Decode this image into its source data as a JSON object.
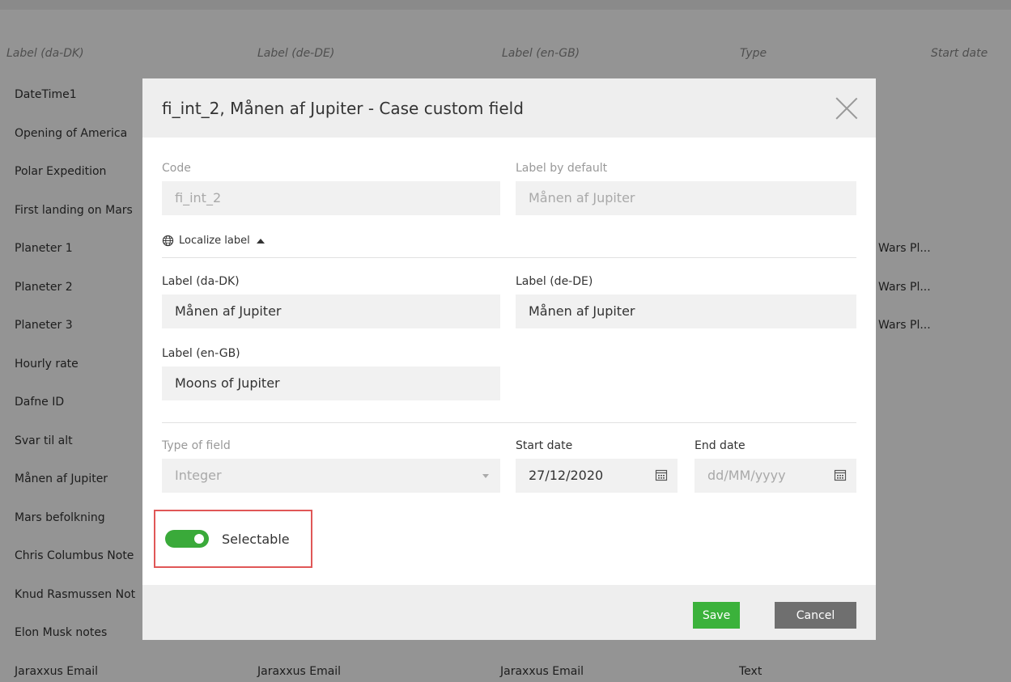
{
  "table": {
    "headers": [
      "Label (da-DK)",
      "Label (de-DE)",
      "Label (en-GB)",
      "Type",
      "Start date"
    ],
    "rows": [
      {
        "c0": "DateTime1",
        "c1": "",
        "c2": "",
        "c3": "",
        "c4": ""
      },
      {
        "c0": "Opening of America",
        "c1": "",
        "c2": "",
        "c3": "",
        "c4": ""
      },
      {
        "c0": "Polar Expedition",
        "c1": "",
        "c2": "",
        "c3": "",
        "c4": ""
      },
      {
        "c0": "First landing on Mars",
        "c1": "",
        "c2": "",
        "c3": "",
        "c4": ""
      },
      {
        "c0": "Planeter 1",
        "c1": "",
        "c2": "",
        "c3": "",
        "c4": "Wars Pl..."
      },
      {
        "c0": "Planeter 2",
        "c1": "",
        "c2": "",
        "c3": "",
        "c4": "Wars Pl..."
      },
      {
        "c0": "Planeter 3",
        "c1": "",
        "c2": "",
        "c3": "",
        "c4": "Wars Pl..."
      },
      {
        "c0": "Hourly rate",
        "c1": "",
        "c2": "",
        "c3": "",
        "c4": ""
      },
      {
        "c0": "Dafne ID",
        "c1": "",
        "c2": "",
        "c3": "",
        "c4": ""
      },
      {
        "c0": "Svar til alt",
        "c1": "",
        "c2": "",
        "c3": "",
        "c4": ""
      },
      {
        "c0": "Månen af Jupiter",
        "c1": "",
        "c2": "",
        "c3": "",
        "c4": ""
      },
      {
        "c0": "Mars befolkning",
        "c1": "",
        "c2": "",
        "c3": "",
        "c4": ""
      },
      {
        "c0": "Chris Columbus Note",
        "c1": "",
        "c2": "",
        "c3": "",
        "c4": ""
      },
      {
        "c0": "Knud Rasmussen Not",
        "c1": "",
        "c2": "",
        "c3": "",
        "c4": ""
      },
      {
        "c0": "Elon Musk notes",
        "c1": "",
        "c2": "",
        "c3": "",
        "c4": ""
      },
      {
        "c0": "Jaraxxus Email",
        "c1": "Jaraxxus Email",
        "c2": "Jaraxxus Email",
        "c3": "Text",
        "c4": ""
      }
    ]
  },
  "modal": {
    "title": "fi_int_2, Månen af Jupiter - Case custom field",
    "code_label": "Code",
    "code_value": "fi_int_2",
    "label_default_label": "Label by default",
    "label_default_value": "Månen af Jupiter",
    "localize_label": "Localize label",
    "da_label": "Label (da-DK)",
    "da_value": "Månen af Jupiter",
    "de_label": "Label (de-DE)",
    "de_value": "Månen af Jupiter",
    "en_label": "Label (en-GB)",
    "en_value": "Moons of Jupiter",
    "type_label": "Type of field",
    "type_value": "Integer",
    "start_label": "Start date",
    "start_value": "27/12/2020",
    "end_label": "End date",
    "end_placeholder": "dd/MM/yyyy",
    "selectable_label": "Selectable",
    "selectable_on": true,
    "save_label": "Save",
    "cancel_label": "Cancel"
  },
  "colors": {
    "accent_green": "#3bb23b",
    "highlight_red": "#e05757",
    "cancel_gray": "#6f6f6f"
  }
}
